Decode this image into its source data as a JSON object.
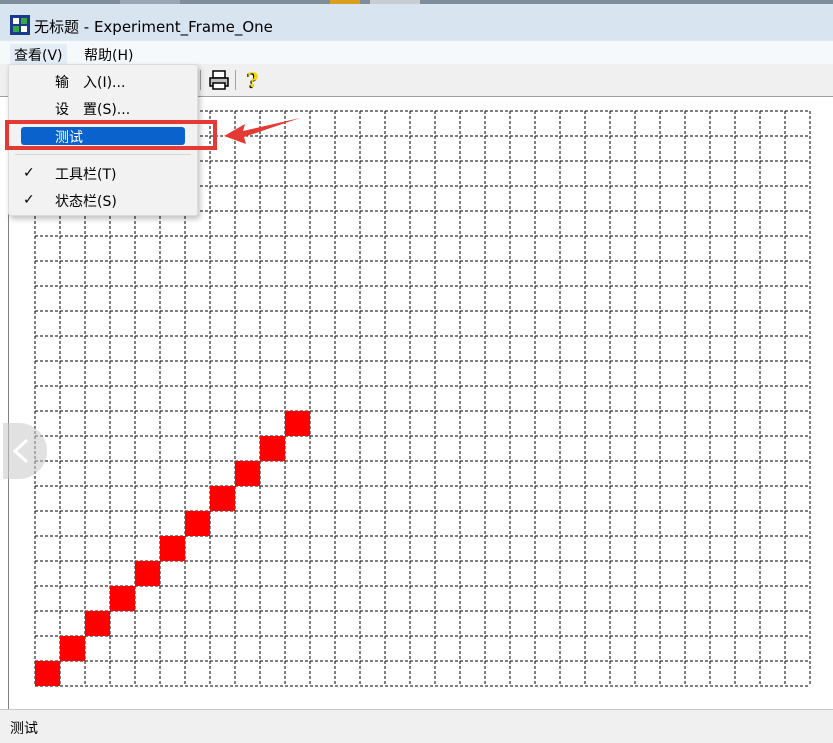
{
  "window": {
    "title": "无标题 - Experiment_Frame_One"
  },
  "menubar": {
    "view": "查看(V)",
    "help": "帮助(H)"
  },
  "view_menu": {
    "items": [
      {
        "label": "输　入(I)...",
        "checked": false
      },
      {
        "label": "设　置(S)...",
        "checked": false
      },
      {
        "label": "测试",
        "checked": false,
        "highlighted": true
      },
      {
        "label": "工具栏(T)",
        "checked": true
      },
      {
        "label": "状态栏(S)",
        "checked": true
      }
    ],
    "check_glyph": "✓"
  },
  "toolbar": {
    "buttons": [
      "print-icon",
      "help-icon"
    ]
  },
  "canvas": {
    "grid": {
      "columns": 31,
      "rows": 23,
      "line_style": "dashed",
      "line_color": "#000000"
    },
    "filled_cells": [
      [
        0,
        22
      ],
      [
        1,
        21
      ],
      [
        2,
        20
      ],
      [
        3,
        19
      ],
      [
        4,
        18
      ],
      [
        5,
        17
      ],
      [
        6,
        16
      ],
      [
        7,
        15
      ],
      [
        8,
        14
      ],
      [
        9,
        13
      ],
      [
        10,
        12
      ]
    ],
    "fill_color": "#ff0000"
  },
  "statusbar": {
    "text": "测试"
  },
  "annotation": {
    "color": "#e53935"
  }
}
